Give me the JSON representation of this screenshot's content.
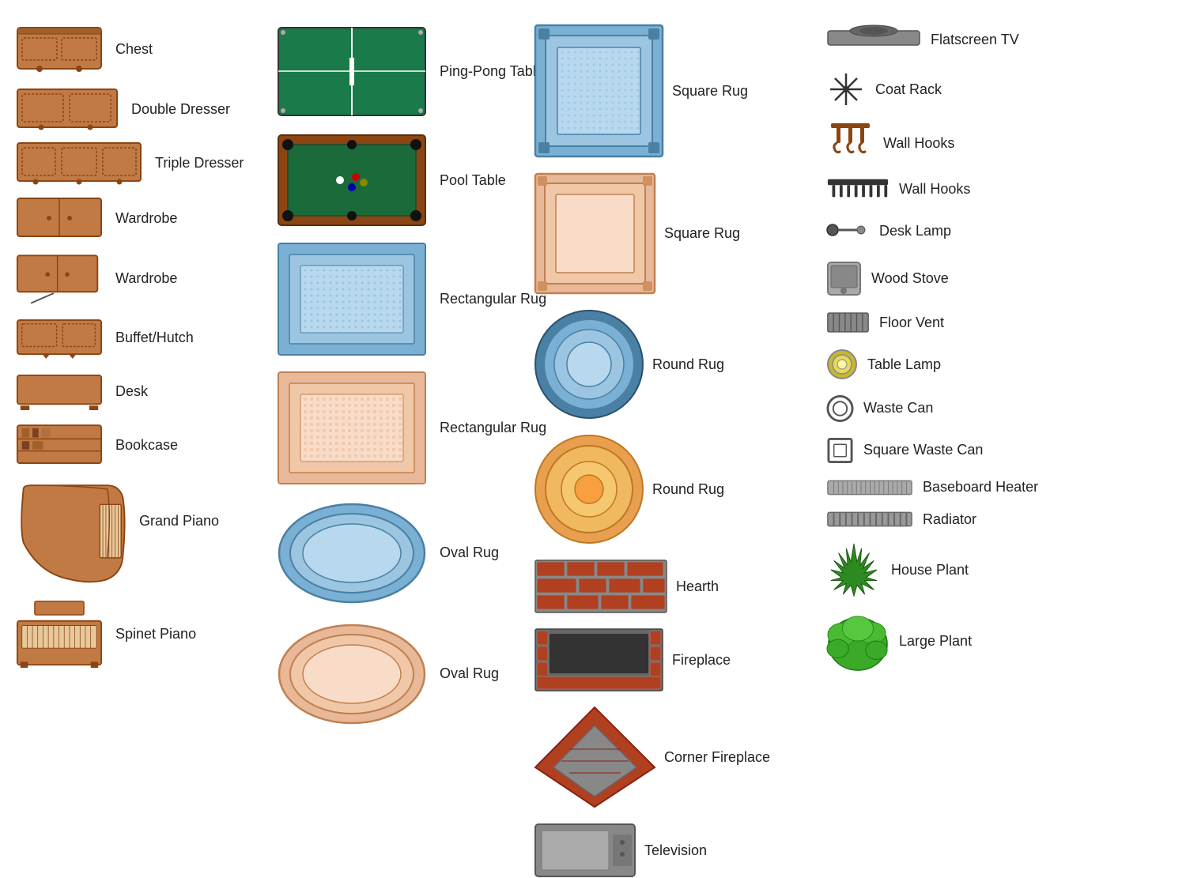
{
  "col1": {
    "items": [
      {
        "label": "Chest"
      },
      {
        "label": "Double Dresser"
      },
      {
        "label": "Triple Dresser"
      },
      {
        "label": "Wardrobe"
      },
      {
        "label": "Wardrobe"
      },
      {
        "label": "Buffet/Hutch"
      },
      {
        "label": "Desk"
      },
      {
        "label": "Bookcase"
      },
      {
        "label": "Grand Piano"
      },
      {
        "label": "Spinet Piano"
      }
    ]
  },
  "col2": {
    "items": [
      {
        "label": "Ping-Pong Table"
      },
      {
        "label": "Pool Table"
      },
      {
        "label": "Rectangular\nRug"
      },
      {
        "label": "Rectangular\nRug"
      },
      {
        "label": "Oval Rug"
      },
      {
        "label": "Oval Rug"
      }
    ]
  },
  "col3": {
    "items": [
      {
        "label": "Square Rug"
      },
      {
        "label": "Square Rug"
      },
      {
        "label": "Round Rug"
      },
      {
        "label": "Round Rug"
      },
      {
        "label": "Hearth"
      },
      {
        "label": "Fireplace"
      },
      {
        "label": "Corner Fireplace"
      },
      {
        "label": "Television"
      }
    ]
  },
  "col4": {
    "items": [
      {
        "label": "Flatscreen TV"
      },
      {
        "label": "Coat Rack"
      },
      {
        "label": "Wall Hooks"
      },
      {
        "label": "Wall Hooks"
      },
      {
        "label": "Desk Lamp"
      },
      {
        "label": "Wood Stove"
      },
      {
        "label": "Floor Vent"
      },
      {
        "label": "Table Lamp"
      },
      {
        "label": "Waste Can"
      },
      {
        "label": "Square Waste Can"
      },
      {
        "label": "Baseboard Heater"
      },
      {
        "label": "Radiator"
      },
      {
        "label": "House Plant"
      },
      {
        "label": "Large Plant"
      }
    ]
  }
}
